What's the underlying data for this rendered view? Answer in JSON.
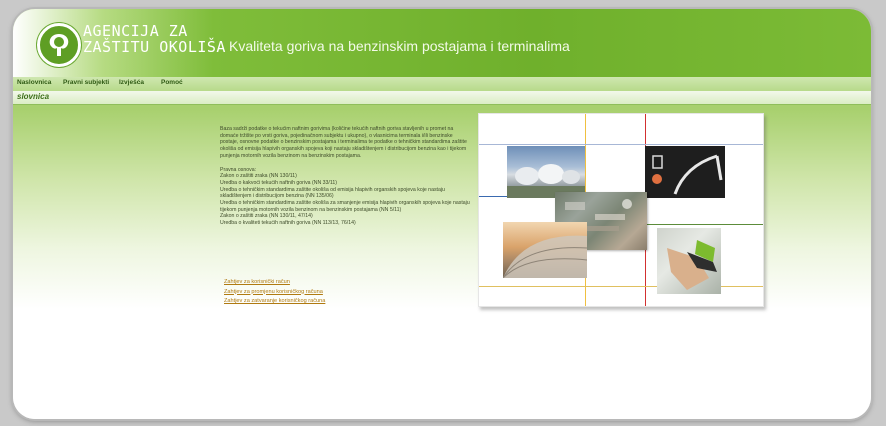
{
  "header": {
    "agency_line1": "AGENCIJA ZA",
    "agency_line2": "ZAŠTITU OKOLIŠA",
    "site_title": "Kvaliteta goriva na benzinskim postajama i terminalima"
  },
  "nav": {
    "items": [
      {
        "label": "Naslovnica"
      },
      {
        "label": "Pravni subjekti"
      },
      {
        "label": "Izvješća"
      },
      {
        "label": "Pomoć"
      }
    ]
  },
  "breadcrumb": {
    "current": "slovnica"
  },
  "content": {
    "intro": "Baza sadrži podatke o tekućim naftnim gorivima (količine tekućih naftnih goriva stavljenih u promet na domaće tržište po vrsti goriva, pojedinačnom subjektu i ukupno), o vlasnicima terminala i/ili benzinske postaje, osnovne podatke o benzinskim postajama i terminalima te podatke o tehničkim standardima zaštite okoliša od emisija hlapivih organskih spojeva koji nastaju skladištenjem i distribucijom benzina kao i tijekom punjenja motornih vozila benzinom na benzinskim postajama.",
    "legal_heading": "Pravna osnova:",
    "legal_items": [
      "Zakon o zaštiti zraka (NN 130/11)",
      "Uredba o kakvoći tekućih naftnih goriva (NN 33/11)",
      "Uredba o tehničkim standardima zaštite okoliša od emisija hlapivih organskih spojeva koje nastaju skladištenjem i distribucijom benzina (NN 135/06)",
      "Uredba o tehničkim standardima zaštite okoliša za smanjenje emisija hlapivih organskih spojeva koje nastaju tijekom punjenja motornih vozila benzinom na benzinskim postajama (NN 5/11)",
      "Zakon o zaštiti zraka (NN 130/11, 47/14)",
      "Uredba o kvaliteti tekućih naftnih goriva (NN 113/13, 76/14)"
    ],
    "links": [
      "Zahtjev za korisnički račun",
      "Zahtjev za promjenu korisničkog računa",
      "Zahtjev za zatvaranje korisničkog računa"
    ]
  },
  "colors": {
    "header_green": "#6fb02c",
    "link_color": "#b07a10",
    "text_color": "#3d4a2a"
  },
  "icons": [
    "tree-logo-icon"
  ]
}
